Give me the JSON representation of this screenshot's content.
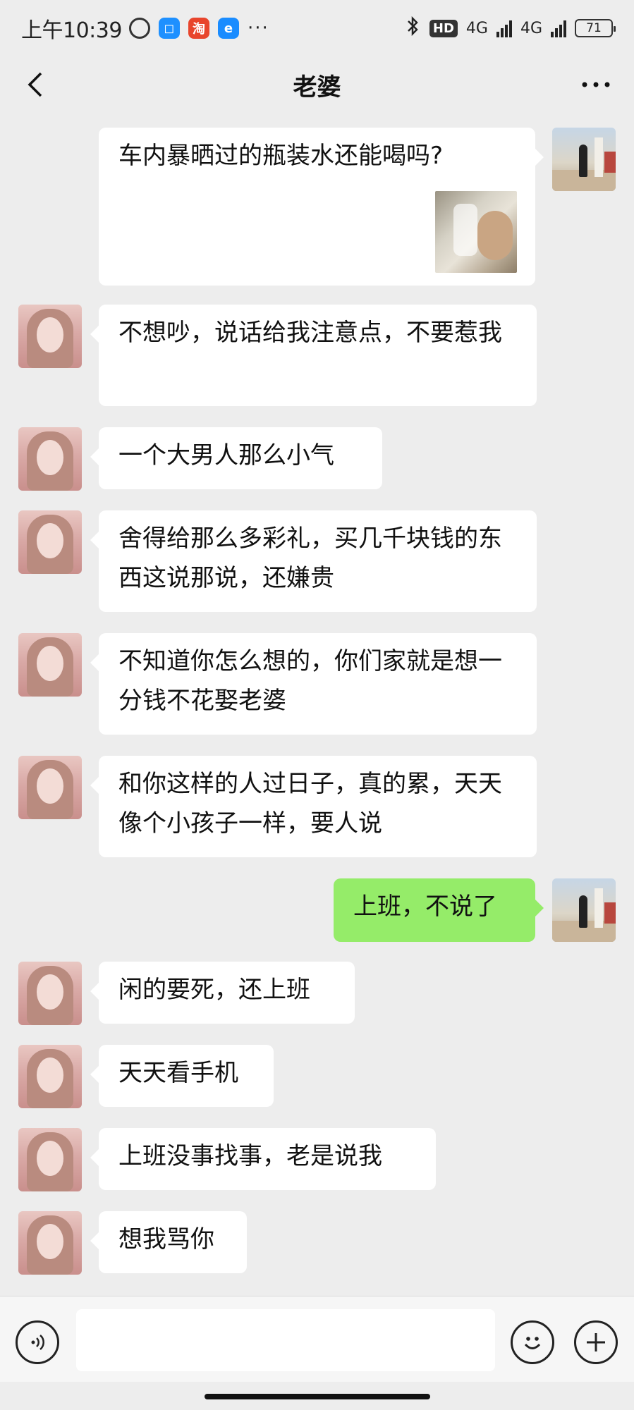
{
  "status_bar": {
    "time": "上午10:39",
    "dots": "···",
    "hd": "HD",
    "network_1": "4G",
    "network_2": "4G",
    "battery": "71"
  },
  "header": {
    "title": "老婆"
  },
  "messages": [
    {
      "sender": "me",
      "text": "车内暴晒过的瓶装水还能喝吗?",
      "has_image": true
    },
    {
      "sender": "wife",
      "text": "不想吵，说话给我注意点，不要惹我"
    },
    {
      "sender": "wife",
      "text": "一个大男人那么小气"
    },
    {
      "sender": "wife",
      "text": "舍得给那么多彩礼，买几千块钱的东西这说那说，还嫌贵"
    },
    {
      "sender": "wife",
      "text": "不知道你怎么想的，你们家就是想一分钱不花娶老婆"
    },
    {
      "sender": "wife",
      "text": "和你这样的人过日子，真的累，天天像个小孩子一样，要人说"
    },
    {
      "sender": "me",
      "text": "上班，不说了"
    },
    {
      "sender": "wife",
      "text": "闲的要死，还上班"
    },
    {
      "sender": "wife",
      "text": "天天看手机"
    },
    {
      "sender": "wife",
      "text": "上班没事找事，老是说我"
    },
    {
      "sender": "wife",
      "text": "想我骂你"
    }
  ],
  "input_bar": {
    "placeholder": ""
  },
  "colors": {
    "background": "#ededed",
    "incoming_bubble": "#ffffff",
    "outgoing_bubble": "#95ec69"
  }
}
